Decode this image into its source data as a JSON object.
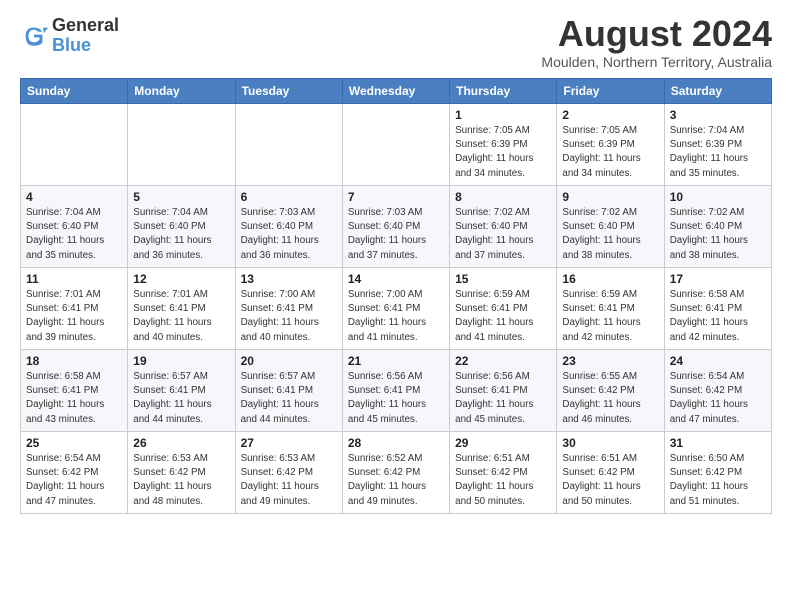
{
  "header": {
    "logo_general": "General",
    "logo_blue": "Blue",
    "title": "August 2024",
    "subtitle": "Moulden, Northern Territory, Australia"
  },
  "weekdays": [
    "Sunday",
    "Monday",
    "Tuesday",
    "Wednesday",
    "Thursday",
    "Friday",
    "Saturday"
  ],
  "weeks": [
    [
      {
        "day": "",
        "info": ""
      },
      {
        "day": "",
        "info": ""
      },
      {
        "day": "",
        "info": ""
      },
      {
        "day": "",
        "info": ""
      },
      {
        "day": "1",
        "info": "Sunrise: 7:05 AM\nSunset: 6:39 PM\nDaylight: 11 hours\nand 34 minutes."
      },
      {
        "day": "2",
        "info": "Sunrise: 7:05 AM\nSunset: 6:39 PM\nDaylight: 11 hours\nand 34 minutes."
      },
      {
        "day": "3",
        "info": "Sunrise: 7:04 AM\nSunset: 6:39 PM\nDaylight: 11 hours\nand 35 minutes."
      }
    ],
    [
      {
        "day": "4",
        "info": "Sunrise: 7:04 AM\nSunset: 6:40 PM\nDaylight: 11 hours\nand 35 minutes."
      },
      {
        "day": "5",
        "info": "Sunrise: 7:04 AM\nSunset: 6:40 PM\nDaylight: 11 hours\nand 36 minutes."
      },
      {
        "day": "6",
        "info": "Sunrise: 7:03 AM\nSunset: 6:40 PM\nDaylight: 11 hours\nand 36 minutes."
      },
      {
        "day": "7",
        "info": "Sunrise: 7:03 AM\nSunset: 6:40 PM\nDaylight: 11 hours\nand 37 minutes."
      },
      {
        "day": "8",
        "info": "Sunrise: 7:02 AM\nSunset: 6:40 PM\nDaylight: 11 hours\nand 37 minutes."
      },
      {
        "day": "9",
        "info": "Sunrise: 7:02 AM\nSunset: 6:40 PM\nDaylight: 11 hours\nand 38 minutes."
      },
      {
        "day": "10",
        "info": "Sunrise: 7:02 AM\nSunset: 6:40 PM\nDaylight: 11 hours\nand 38 minutes."
      }
    ],
    [
      {
        "day": "11",
        "info": "Sunrise: 7:01 AM\nSunset: 6:41 PM\nDaylight: 11 hours\nand 39 minutes."
      },
      {
        "day": "12",
        "info": "Sunrise: 7:01 AM\nSunset: 6:41 PM\nDaylight: 11 hours\nand 40 minutes."
      },
      {
        "day": "13",
        "info": "Sunrise: 7:00 AM\nSunset: 6:41 PM\nDaylight: 11 hours\nand 40 minutes."
      },
      {
        "day": "14",
        "info": "Sunrise: 7:00 AM\nSunset: 6:41 PM\nDaylight: 11 hours\nand 41 minutes."
      },
      {
        "day": "15",
        "info": "Sunrise: 6:59 AM\nSunset: 6:41 PM\nDaylight: 11 hours\nand 41 minutes."
      },
      {
        "day": "16",
        "info": "Sunrise: 6:59 AM\nSunset: 6:41 PM\nDaylight: 11 hours\nand 42 minutes."
      },
      {
        "day": "17",
        "info": "Sunrise: 6:58 AM\nSunset: 6:41 PM\nDaylight: 11 hours\nand 42 minutes."
      }
    ],
    [
      {
        "day": "18",
        "info": "Sunrise: 6:58 AM\nSunset: 6:41 PM\nDaylight: 11 hours\nand 43 minutes."
      },
      {
        "day": "19",
        "info": "Sunrise: 6:57 AM\nSunset: 6:41 PM\nDaylight: 11 hours\nand 44 minutes."
      },
      {
        "day": "20",
        "info": "Sunrise: 6:57 AM\nSunset: 6:41 PM\nDaylight: 11 hours\nand 44 minutes."
      },
      {
        "day": "21",
        "info": "Sunrise: 6:56 AM\nSunset: 6:41 PM\nDaylight: 11 hours\nand 45 minutes."
      },
      {
        "day": "22",
        "info": "Sunrise: 6:56 AM\nSunset: 6:41 PM\nDaylight: 11 hours\nand 45 minutes."
      },
      {
        "day": "23",
        "info": "Sunrise: 6:55 AM\nSunset: 6:42 PM\nDaylight: 11 hours\nand 46 minutes."
      },
      {
        "day": "24",
        "info": "Sunrise: 6:54 AM\nSunset: 6:42 PM\nDaylight: 11 hours\nand 47 minutes."
      }
    ],
    [
      {
        "day": "25",
        "info": "Sunrise: 6:54 AM\nSunset: 6:42 PM\nDaylight: 11 hours\nand 47 minutes."
      },
      {
        "day": "26",
        "info": "Sunrise: 6:53 AM\nSunset: 6:42 PM\nDaylight: 11 hours\nand 48 minutes."
      },
      {
        "day": "27",
        "info": "Sunrise: 6:53 AM\nSunset: 6:42 PM\nDaylight: 11 hours\nand 49 minutes."
      },
      {
        "day": "28",
        "info": "Sunrise: 6:52 AM\nSunset: 6:42 PM\nDaylight: 11 hours\nand 49 minutes."
      },
      {
        "day": "29",
        "info": "Sunrise: 6:51 AM\nSunset: 6:42 PM\nDaylight: 11 hours\nand 50 minutes."
      },
      {
        "day": "30",
        "info": "Sunrise: 6:51 AM\nSunset: 6:42 PM\nDaylight: 11 hours\nand 50 minutes."
      },
      {
        "day": "31",
        "info": "Sunrise: 6:50 AM\nSunset: 6:42 PM\nDaylight: 11 hours\nand 51 minutes."
      }
    ]
  ]
}
